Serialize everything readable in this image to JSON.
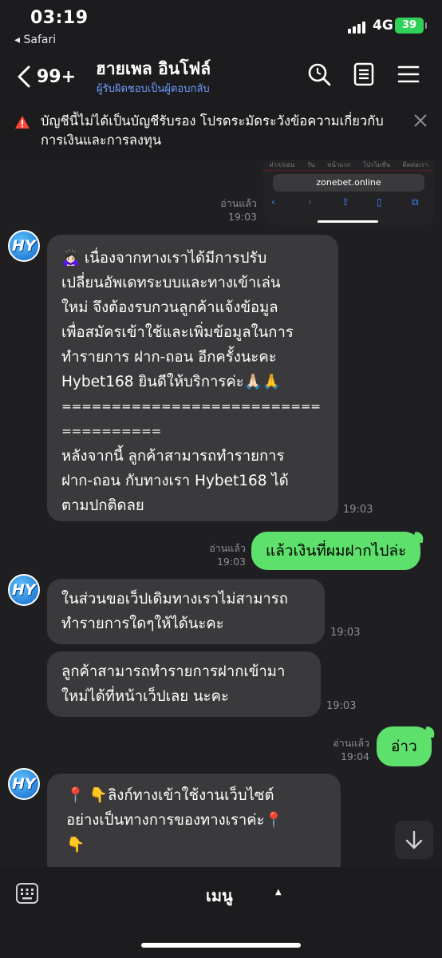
{
  "status_bar": {
    "time": "03:19",
    "back_app": "◂ Safari",
    "network": "4G",
    "battery": "39"
  },
  "header": {
    "unread_count": "99+",
    "title": "ฮายเพล อินโฟล์",
    "subtitle": "ผู้รับผิดชอบเป็นผู้ตอบกลับ"
  },
  "warning": {
    "text": "บัญชีนี้ไม่ได้เป็นบัญชีรับรอง โปรดระมัดระวังข้อความเกี่ยวกับการเงินและการลงทุน"
  },
  "screenshot_preview": {
    "tabs": [
      "ฝาก/ถอน",
      "วัน",
      "หน้าแรก",
      "โปรโมชั่น",
      "ติดต่อเรา"
    ],
    "url": "zonebet.online"
  },
  "messages": [
    {
      "id": "m1",
      "direction": "out",
      "read_label": "อ่านแล้ว",
      "time": "19:03"
    },
    {
      "id": "m2",
      "direction": "in",
      "avatar_text": "HY",
      "lines": [
        "🙇🏻‍♀️ เนื่องจากทางเราได้มีการปรับ",
        "เปลี่ยนอัพเดทระบบและทางเข้าเล่น",
        "ใหม่ จึงต้องรบกวนลูกค้าแจ้งข้อมูล",
        "เพื่อสมัครเข้าใช้และเพิ่มข้อมูลในการ",
        "ทำรายการ ฝาก-ถอน อีกครั้งนะคะ",
        "Hybet168 ยินดีให้บริการค่ะ🙏🏻🙏",
        "==========================",
        "==========",
        "หลังจากนี้ ลูกค้าสามารถทำรายการ",
        "ฝาก-ถอน กับทางเรา Hybet168 ได้",
        "ตามปกติดลย"
      ],
      "time": "19:03"
    },
    {
      "id": "m3",
      "direction": "out",
      "text": "แล้วเงินที่ผมฝากไปล่ะ",
      "read_label": "อ่านแล้ว",
      "time": "19:03"
    },
    {
      "id": "m4",
      "direction": "in",
      "avatar_text": "HY",
      "lines": [
        "ในส่วนขอเว็ปเดิมทางเราไม่สามารถ",
        "ทำรายการใดๆให้ได้นะคะ"
      ],
      "time": "19:03"
    },
    {
      "id": "m5",
      "direction": "in",
      "lines": [
        "ลูกค้าสามารถทำรายการฝากเข้ามา",
        "ใหม่ได้ที่หน้าเว็ปเลย นะคะ"
      ],
      "time": "19:03"
    },
    {
      "id": "m6",
      "direction": "out",
      "text": "อ่าว",
      "read_label": "อ่านแล้ว",
      "time": "19:04"
    },
    {
      "id": "m7",
      "direction": "in",
      "avatar_text": "HY",
      "lines": [
        "📍 👇ลิงก์ทางเข้าใช้งานเว็บไซต์",
        "อย่างเป็นทางการของทางเราค่ะ📍",
        "👇"
      ]
    }
  ],
  "bottom_bar": {
    "menu_label": "เมนู",
    "menu_caret": "▲"
  },
  "colors": {
    "background": "#1c1c1e",
    "incoming_bubble": "#3a3a3c",
    "outgoing_bubble": "#5ee06c",
    "warning_icon": "#ff453a",
    "subtitle": "#6e9cff",
    "battery": "#30d158"
  },
  "icons": [
    "back-chevron-icon",
    "search-icon",
    "notes-icon",
    "menu-icon",
    "warning-icon",
    "close-icon",
    "scroll-down-icon",
    "keyboard-icon"
  ]
}
